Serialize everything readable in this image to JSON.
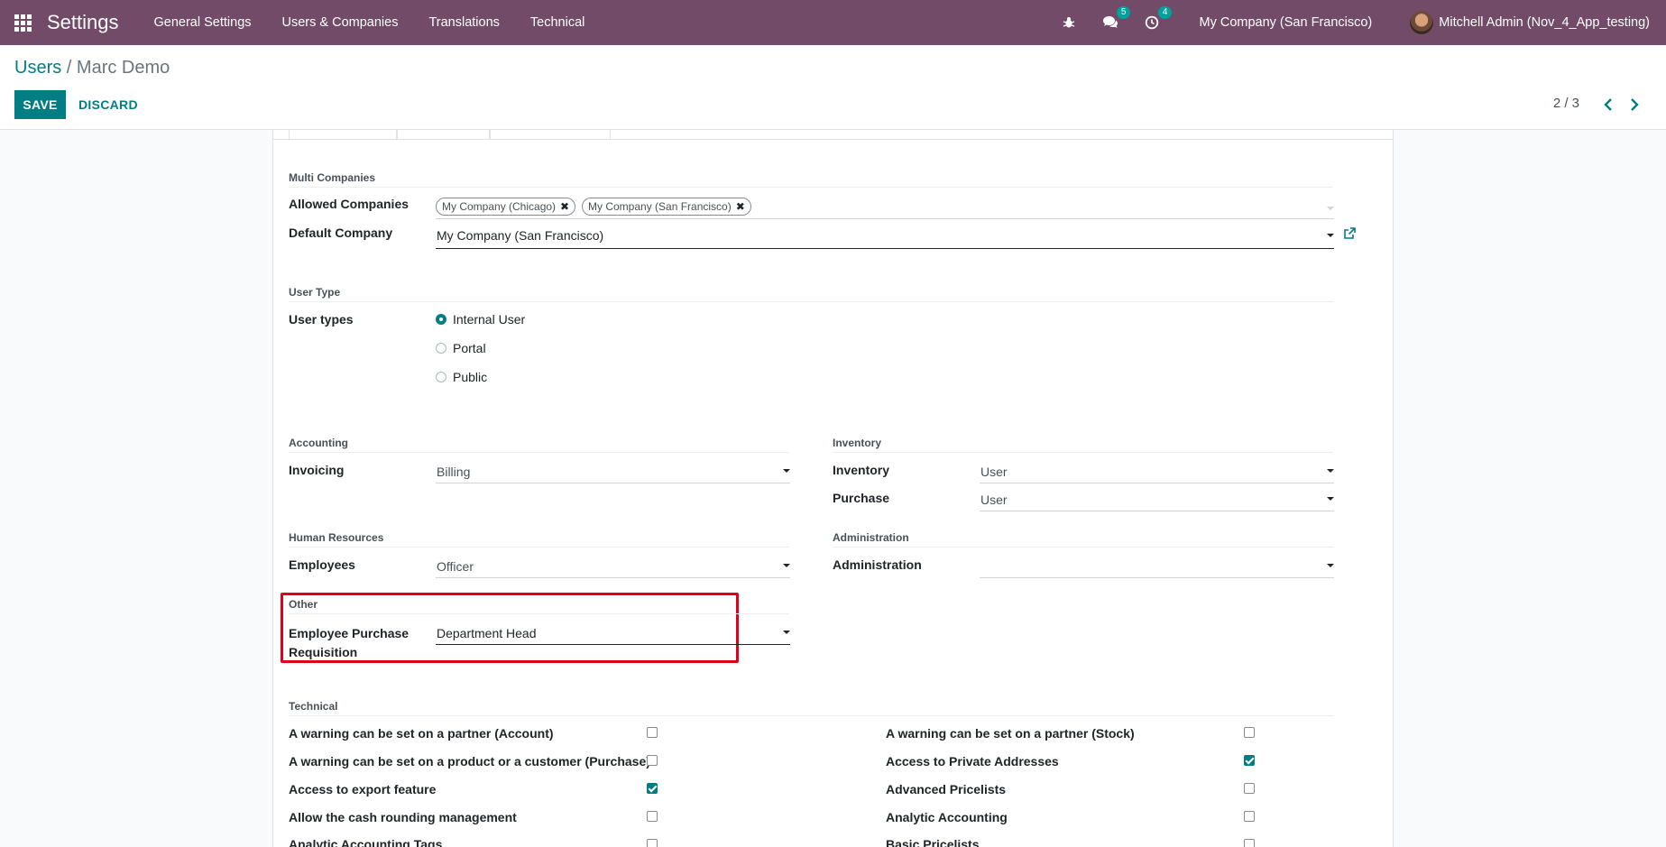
{
  "navbar": {
    "brand": "Settings",
    "menu": [
      "General Settings",
      "Users & Companies",
      "Translations",
      "Technical"
    ],
    "messages_count": "5",
    "activities_count": "4",
    "company": "My Company (San Francisco)",
    "user": "Mitchell Admin (Nov_4_App_testing)"
  },
  "control_panel": {
    "breadcrumb_parent": "Users",
    "breadcrumb_sep": "/",
    "breadcrumb_current": "Marc Demo",
    "save_label": "SAVE",
    "discard_label": "DISCARD",
    "pager": "2 / 3"
  },
  "form": {
    "multi_companies": {
      "title": "Multi Companies",
      "allowed_label": "Allowed Companies",
      "allowed_tags": [
        "My Company (Chicago)",
        "My Company (San Francisco)"
      ],
      "default_label": "Default Company",
      "default_value": "My Company (San Francisco)"
    },
    "user_type": {
      "title": "User Type",
      "label": "User types",
      "options": [
        "Internal User",
        "Portal",
        "Public"
      ],
      "selected": "Internal User"
    },
    "accounting": {
      "title": "Accounting",
      "invoicing_label": "Invoicing",
      "invoicing_value": "Billing"
    },
    "inventory": {
      "title": "Inventory",
      "inventory_label": "Inventory",
      "inventory_value": "User",
      "purchase_label": "Purchase",
      "purchase_value": "User"
    },
    "human_resources": {
      "title": "Human Resources",
      "employees_label": "Employees",
      "employees_value": "Officer"
    },
    "administration": {
      "title": "Administration",
      "administration_label": "Administration",
      "administration_value": ""
    },
    "other": {
      "title": "Other",
      "label_line1": "Employee Purchase",
      "label_line2": "Requisition",
      "value": "Department Head"
    },
    "technical": {
      "title": "Technical",
      "left": [
        {
          "label": "A warning can be set on a partner (Account)",
          "checked": false
        },
        {
          "label": "A warning can be set on a product or a customer (Purchase)",
          "checked": false
        },
        {
          "label": "Access to export feature",
          "checked": true
        },
        {
          "label": "Allow the cash rounding management",
          "checked": false
        },
        {
          "label": "Analytic Accounting Tags",
          "checked": false
        }
      ],
      "right": [
        {
          "label": "A warning can be set on a partner (Stock)",
          "checked": false
        },
        {
          "label": "Access to Private Addresses",
          "checked": true
        },
        {
          "label": "Advanced Pricelists",
          "checked": false
        },
        {
          "label": "Analytic Accounting",
          "checked": false
        },
        {
          "label": "Basic Pricelists",
          "checked": false
        }
      ]
    }
  },
  "colors": {
    "navbar": "#714b67",
    "primary": "#017e84",
    "highlight": "#e0001a"
  }
}
